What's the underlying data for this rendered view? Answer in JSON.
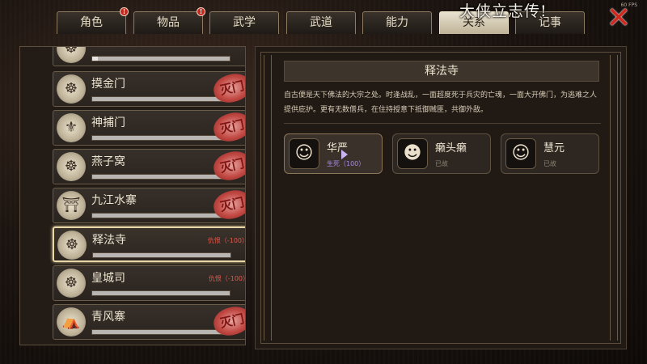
{
  "tabs": [
    {
      "label": "角色",
      "badge": "!"
    },
    {
      "label": "物品",
      "badge": "!"
    },
    {
      "label": "武学",
      "badge": ""
    },
    {
      "label": "武道",
      "badge": ""
    },
    {
      "label": "能力",
      "badge": ""
    },
    {
      "label": "关系",
      "badge": ""
    },
    {
      "label": "记事",
      "badge": ""
    }
  ],
  "active_tab": "关系",
  "overlay_title": "大侠立志传!",
  "fps_label": "60 FPS",
  "close_glyph": "✕",
  "sects": [
    {
      "name": "摸金门",
      "icon": "☸",
      "relation": "",
      "stamp": "灭门",
      "bar": 0.0
    },
    {
      "name": "神捕门",
      "icon": "⚜",
      "relation": "",
      "stamp": "灭门",
      "bar": 0.0
    },
    {
      "name": "燕子窝",
      "icon": "☸",
      "relation": "",
      "stamp": "灭门",
      "bar": 0.0
    },
    {
      "name": "九江水寨",
      "icon": "⛩",
      "relation": "",
      "stamp": "灭门",
      "bar": 0.0
    },
    {
      "name": "释法寺",
      "icon": "☸",
      "relation": "仇恨（-100）",
      "stamp": "",
      "bar": 0.0,
      "selected": true
    },
    {
      "name": "皇城司",
      "icon": "☸",
      "relation": "仇恨（-100）",
      "stamp": "",
      "bar": 0.0
    },
    {
      "name": "青风寨",
      "icon": "⛺",
      "relation": "",
      "stamp": "灭门",
      "bar": 0.0
    }
  ],
  "detail": {
    "title": "释法寺",
    "description": "自古便是天下佛法的大宗之处。时逢战乱，一面超度死于兵灾的亡魂，一面大开佛门，为逃难之人提供庇护。更有无数僧兵，在住持授意下抵御贼匪，共御外敌。",
    "members": [
      {
        "name": "华严",
        "status": "生死（100）",
        "alive": true,
        "icon": "☺"
      },
      {
        "name": "癞头癞",
        "status": "已故",
        "alive": false,
        "icon": "☻"
      },
      {
        "name": "慧元",
        "status": "已故",
        "alive": false,
        "icon": "☺"
      }
    ]
  },
  "colors": {
    "accent_red": "#c2281d",
    "alive_purple": "#a888e6",
    "relation_red": "#e2564a"
  }
}
